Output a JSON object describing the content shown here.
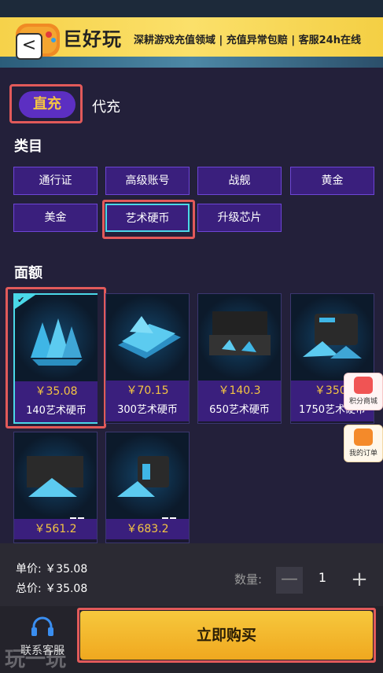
{
  "header": {
    "brand": "巨好玩",
    "slogan": "深耕游戏充值领域 | 充值异常包赔 | 客服24h在线",
    "back_glyph": "<"
  },
  "tabs": [
    {
      "label": "直充",
      "active": true
    },
    {
      "label": "代充",
      "active": false
    }
  ],
  "category_section": {
    "title": "类目",
    "items": [
      "通行证",
      "高级账号",
      "战舰",
      "黄金",
      "美金",
      "艺术硬币",
      "升级芯片"
    ],
    "selected": "艺术硬币"
  },
  "denomination_section": {
    "title": "面额",
    "cards": [
      {
        "price": "￥35.08",
        "name": "140艺术硬币",
        "selected": true
      },
      {
        "price": "￥70.15",
        "name": "300艺术硬币",
        "selected": false
      },
      {
        "price": "￥140.3",
        "name": "650艺术硬币",
        "selected": false
      },
      {
        "price": "￥350.",
        "name": "1750艺术硬币",
        "selected": false
      },
      {
        "price": "￥561.2",
        "name": "",
        "selected": false
      },
      {
        "price": "￥683.2",
        "name": "",
        "selected": false
      }
    ]
  },
  "floating": {
    "points_mall": "积分商城",
    "my_orders": "我的订单"
  },
  "footer": {
    "unit_price": "单价: ￥35.08",
    "total_price": "总价: ￥35.08",
    "qty_label": "数量:",
    "qty_minus": "—",
    "qty_value": "1",
    "qty_plus": "+",
    "service_label": "联系客服",
    "buy_label": "立即购买",
    "watermark": "玩一玩"
  },
  "colors": {
    "background": "#23203a",
    "accent_purple": "#3a1f7d",
    "price_gold": "#f4c542",
    "selected_cyan": "#4ad8e8",
    "buy_button": "#f0a81f"
  }
}
